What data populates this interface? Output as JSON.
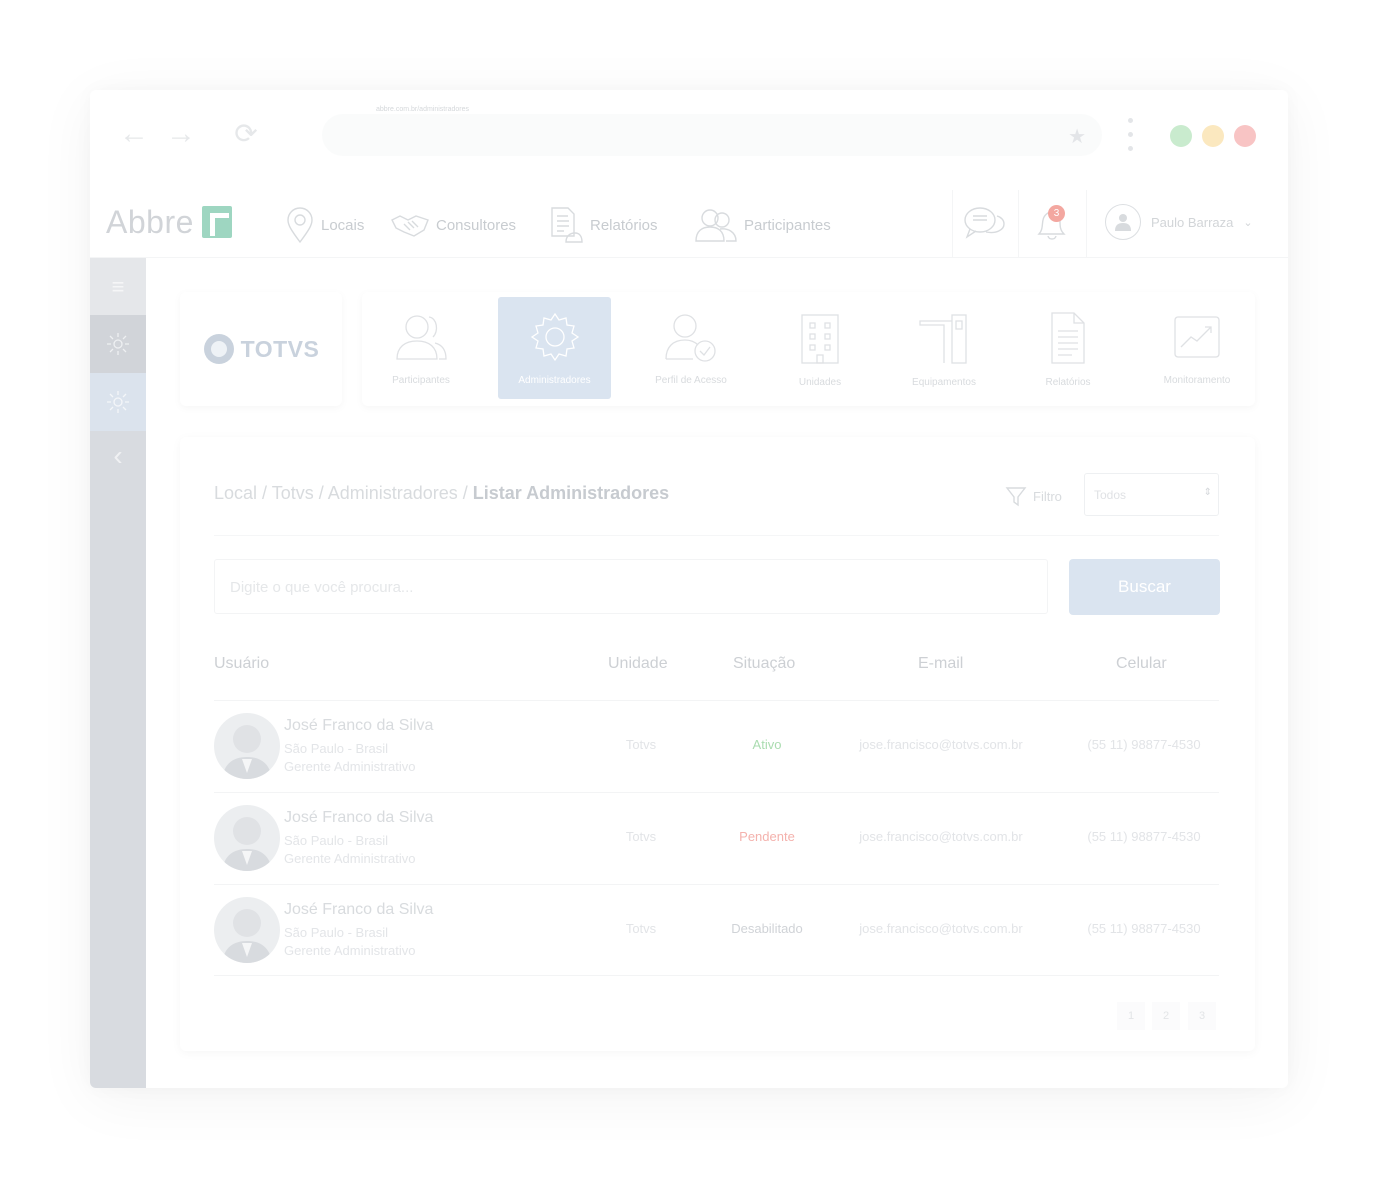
{
  "browser": {
    "url": "abbre.com.br/administradores",
    "dot_colors": [
      "#c9ebce",
      "#fbe8bf",
      "#f8c4c4"
    ]
  },
  "app": {
    "logo_text": "Abbre",
    "nav": [
      {
        "label": "Locais",
        "icon": "pin-icon"
      },
      {
        "label": "Consultores",
        "icon": "handshake-icon"
      },
      {
        "label": "Relatórios",
        "icon": "report-icon"
      },
      {
        "label": "Participantes",
        "icon": "people-icon"
      }
    ],
    "notifications_count": "3",
    "user_name": "Paulo Barraza"
  },
  "brand": {
    "name": "TOTVS"
  },
  "modules": [
    {
      "label": "Participantes",
      "icon": "participants-icon",
      "active": false
    },
    {
      "label": "Administradores",
      "icon": "gear-icon",
      "active": true
    },
    {
      "label": "Perfil de Acesso",
      "icon": "access-profile-icon",
      "active": false
    },
    {
      "label": "Unidades",
      "icon": "building-icon",
      "active": false
    },
    {
      "label": "Equipamentos",
      "icon": "turnstile-icon",
      "active": false
    },
    {
      "label": "Relatórios",
      "icon": "document-icon",
      "active": false
    },
    {
      "label": "Monitoramento",
      "icon": "trend-chart-icon",
      "active": false
    }
  ],
  "breadcrumb": {
    "path": "Local / Totvs / Administradores / ",
    "current": "Listar Administradores"
  },
  "filter": {
    "label": "Filtro",
    "selected": "Todos"
  },
  "search": {
    "placeholder": "Digite o que você procura...",
    "button": "Buscar"
  },
  "table": {
    "headers": [
      "Usuário",
      "Unidade",
      "Situação",
      "E-mail",
      "Celular"
    ],
    "rows": [
      {
        "name": "José Franco da Silva",
        "location": "São Paulo - Brasil",
        "role": "Gerente Administrativo",
        "unit": "Totvs",
        "status": "Ativo",
        "email": "jose.francisco@totvs.com.br",
        "phone": "(55 11) 98877-4530"
      },
      {
        "name": "José Franco da Silva",
        "location": "São Paulo - Brasil",
        "role": "Gerente Administrativo",
        "unit": "Totvs",
        "status": "Pendente",
        "email": "jose.francisco@totvs.com.br",
        "phone": "(55 11) 98877-4530"
      },
      {
        "name": "José Franco da Silva",
        "location": "São Paulo - Brasil",
        "role": "Gerente Administrativo",
        "unit": "Totvs",
        "status": "Desabilitado",
        "email": "jose.francisco@totvs.com.br",
        "phone": "(55 11) 98877-4530"
      }
    ],
    "status_colors": {
      "Ativo": "#aadcb0",
      "Pendente": "#f4b2ad",
      "Desabilitado": "#d0d3d7"
    }
  },
  "pagination": [
    "1",
    "2",
    "3"
  ]
}
